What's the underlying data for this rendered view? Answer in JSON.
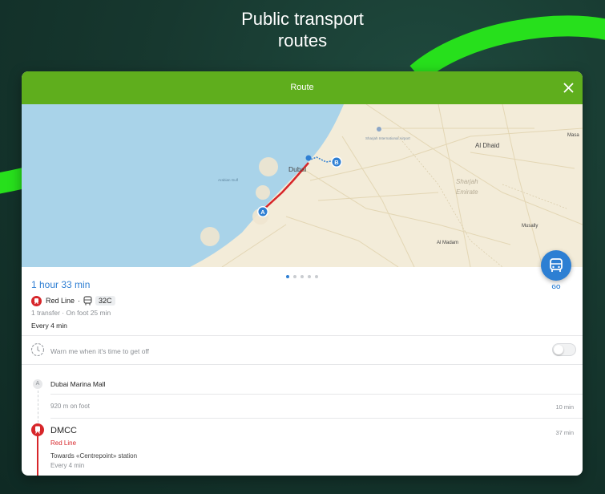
{
  "hero": {
    "line1": "Public transport",
    "line2": "routes"
  },
  "header": {
    "title": "Route"
  },
  "map": {
    "labels": {
      "dubai": "Dubai",
      "arabian_gulf": "Arabian Gulf",
      "sharjah_airport": "Sharjah International Airport",
      "al_dhaid": "Al Dhaid",
      "sharjah_emirate_1": "Sharjah",
      "sharjah_emirate_2": "Emirate",
      "musally": "Musally",
      "al_madam": "Al Madam",
      "masafi": "Masa"
    },
    "markers": {
      "a": "A",
      "b": "B"
    },
    "colors": {
      "water": "#a9d3e9",
      "land": "#f3ecd9",
      "route": "#d7262a",
      "transit": "#2f7fd3"
    }
  },
  "pager": {
    "count": 5,
    "active": 0
  },
  "go": {
    "label": "GO"
  },
  "summary": {
    "duration": "1 hour 33 min",
    "metro_line": "Red Line",
    "separator": "·",
    "bus_number": "32C",
    "transfers": "1 transfer · On foot 25 min",
    "frequency": "Every 4 min"
  },
  "alert": {
    "text": "Warn me when it's time to get off",
    "enabled": false
  },
  "steps": {
    "start_marker": "A",
    "start_name": "Dubai Marina Mall",
    "walk": "920 m on foot",
    "walk_time": "10 min",
    "station": "DMCC",
    "station_line": "Red Line",
    "station_time": "37 min",
    "towards": "Towards «Centrepoint» station",
    "station_freq": "Every 4 min"
  }
}
